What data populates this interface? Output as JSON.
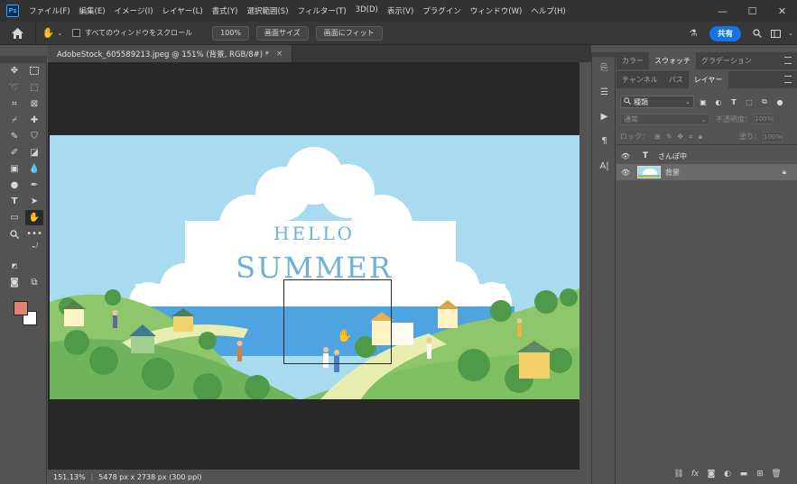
{
  "app": {
    "logo_text": "Ps"
  },
  "menu": [
    "ファイル(F)",
    "編集(E)",
    "イメージ(I)",
    "レイヤー(L)",
    "書式(Y)",
    "選択範囲(S)",
    "フィルター(T)",
    "3D(D)",
    "表示(V)",
    "プラグイン",
    "ウィンドウ(W)",
    "ヘルプ(H)"
  ],
  "window_controls": {
    "minimize": "—",
    "maximize": "☐",
    "close": "✕"
  },
  "options_bar": {
    "scroll_all_label": "すべてのウィンドウをスクロール",
    "zoom_100": "100%",
    "fit_screen": "画面サイズ",
    "fill_screen": "画面にフィット",
    "share_label": "共有"
  },
  "document": {
    "tab_title": "AdobeStock_605589213.jpeg @ 151% (背景, RGB/8#) *",
    "tab_close": "×"
  },
  "artwork": {
    "hello": "HELLO",
    "summer": "SUMMER",
    "colors": {
      "sky": "#a8dbf0",
      "cloud": "#ffffff",
      "sea": "#4fa3e0",
      "hills": "#9fd07a",
      "text": "#6fb0d8"
    }
  },
  "status": {
    "zoom": "151.13%",
    "doc_info": "5478 px x 2738 px (300 ppi)"
  },
  "panels": {
    "top_tabs": [
      "カラー",
      "スウォッチ",
      "グラデーション"
    ],
    "top_active": "スウォッチ",
    "layer_tabs": [
      "チャンネル",
      "パス",
      "レイヤー"
    ],
    "layer_active": "レイヤー",
    "filter_kind": "種類",
    "blend_mode": "通常",
    "opacity_label": "不透明度：",
    "opacity_value": "100%",
    "lock_label": "ロック：",
    "fill_label": "塗り：",
    "fill_value": "100%",
    "layers": [
      {
        "name": "さんぽ中",
        "type": "T",
        "selected": false
      },
      {
        "name": "背景",
        "type": "image",
        "selected": true
      }
    ]
  },
  "colors": {
    "foreground": "#e2816f",
    "background": "#ffffff",
    "accent": "#1473e6"
  }
}
